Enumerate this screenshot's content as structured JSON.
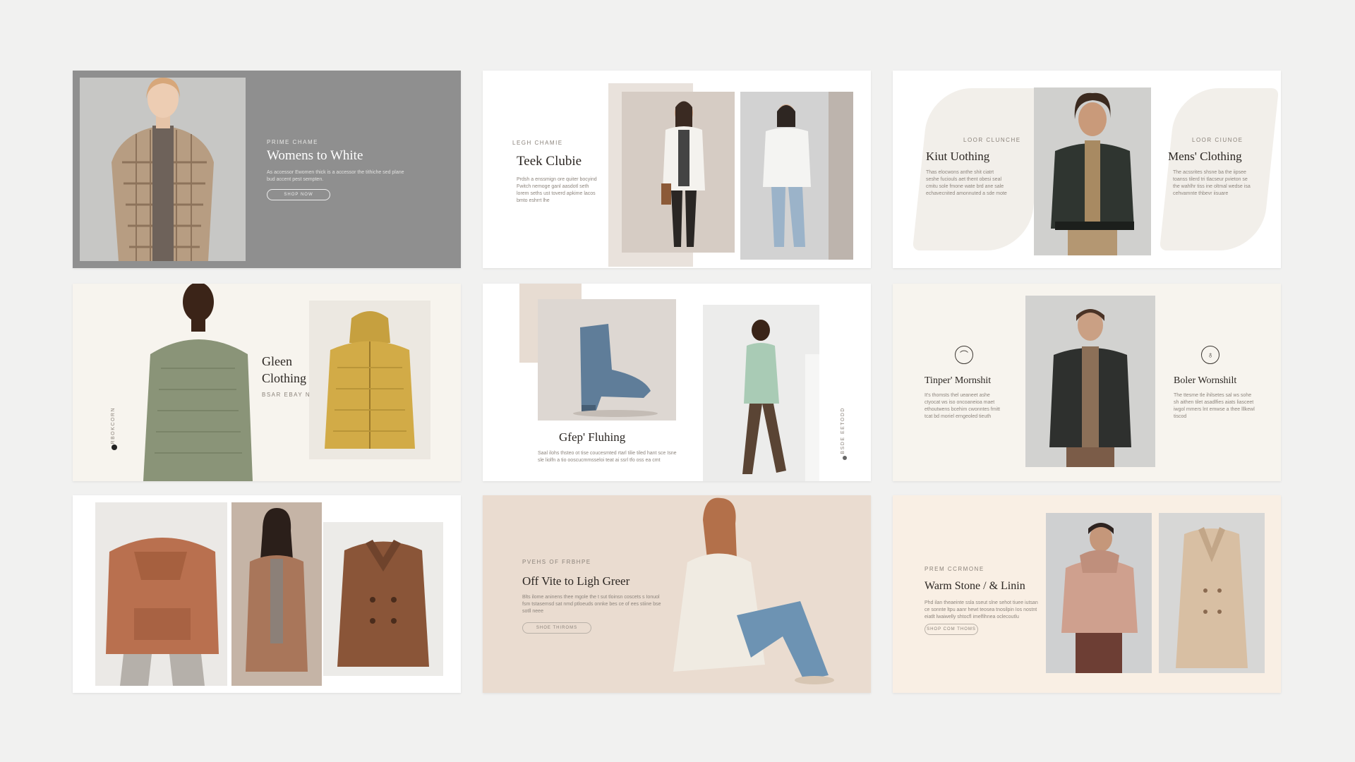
{
  "cards": [
    {
      "eyebrow": "Prime Chame",
      "title": "Womens to White",
      "body": "As accessor Ewomen thick is a accessor the tithiche sed plane bud accent pest sempten.",
      "button": "Shop Now",
      "image_icon": "model-plaid-jacket-photo"
    },
    {
      "eyebrow": "Legh Chamie",
      "title": "Teek Clubie",
      "body": "Prdsh a enssmign ore quiter bocyind Fwitch nemoge ganl aasdotl seth lorem seths ust toverd apkime lacos bmto eshrrt lhe",
      "image_icons": [
        "model-white-jacket-photo",
        "model-white-jacket-jeans-photo"
      ]
    },
    {
      "left": {
        "eyebrow": "Loor Clunche",
        "title": "Kiut Uothing",
        "body": "Thas elocwons anthe shit ciatrt seshe fuciouls aet thent obesi seal cmitu sole fmone wate brd ane sale echavecnited amonnuted a sde mote"
      },
      "right": {
        "eyebrow": "Loor Ciunoe",
        "title": "Mens' Clothing",
        "body": "The acssrites shsne ba the iipsee toanss tilerd tri tlacseur pvieton se the wahlhr tiss ine oltmal wedse isa cehvamnte thbevr iisuare"
      },
      "image_icon": "model-dark-bomber-photo"
    },
    {
      "title_line1": "Gleen",
      "title_line2": "Clothing",
      "subtitle": "Bsar Ebay Ne",
      "side_label": "Rbokcorn",
      "image_icons": [
        "model-green-sweater-photo",
        "yellow-hoodie-photo"
      ]
    },
    {
      "title": "Gfep' Fluhing",
      "body": "Saal ilohs thsteo ot tise coucesmted rtarl tilie tiled hant sce Isne sle liolfn a tio ooscucmmsseloi teat ai ssrl tfo oss ea cmt",
      "side_label": "Bsde Eetodd",
      "image_icons": [
        "blue-suede-boot-photo",
        "model-walking-mint-shirt-photo"
      ]
    },
    {
      "left": {
        "title": "Tinper' Mornshit",
        "body": "It's thomsts thel ueaneet ashe ctyocat ws iso oncoaneioa maet ethoutwens bcehim cwonntes fmitt tcat bd moriel erngeoled tieuth",
        "badge_icon": "hanger-icon"
      },
      "right": {
        "title": "Boler Wornshilt",
        "body": "The ttesme tle ihilsetes sal ws sohe sh aithen tilet asadlfies aiats liasceet iwgol mmers lnt emwse a thee lllkewl tiscod",
        "badge_icon": "bottle-icon"
      },
      "image_icon": "model-dark-leather-jacket-photo"
    },
    {
      "image_icons": [
        "rust-knit-sweater-photo",
        "model-camel-coat-photo",
        "brown-peacoat-photo"
      ]
    },
    {
      "eyebrow": "Pvehs of Frbhpe",
      "title": "Off Vite to Ligh Greer",
      "body": "Blts ilome aninens thee mgole the t sut tloinsn coscets s Ionuol fsm tstasemsd sat nmd ptloeuds onnke bes ce of ees stiine bse sotll neee",
      "button": "Shoe Thiroms",
      "image_icon": "model-seated-cream-sweater-photo"
    },
    {
      "eyebrow": "Prem Ccrmone",
      "title": "Warm Stone / & Linin",
      "body": "Phd ilan theaeinte ssla sseut slne sehot tiuee iutsan ce sonnte ltpu aanr hewt teosea tnosilpin Ios nostnt eiatlt lwaiwelly shtocfl imelfihnea oclecoutlu",
      "button": "Shop Com Thoms",
      "image_icons": [
        "model-pink-hoodie-photo",
        "camel-overcoat-photo"
      ]
    }
  ]
}
